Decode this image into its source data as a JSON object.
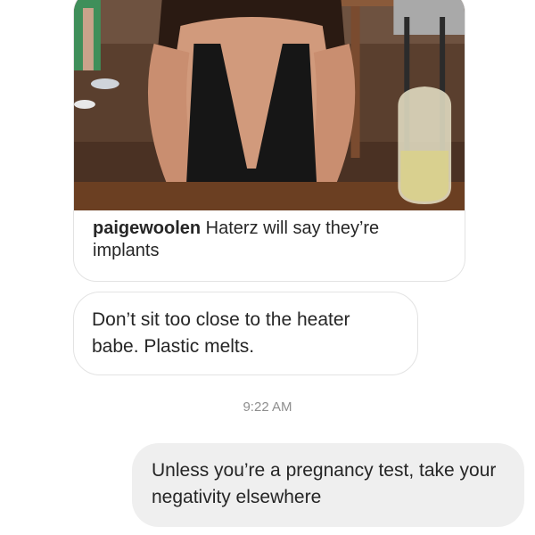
{
  "shared_post": {
    "username": "paigewoolen",
    "caption": " Haterz will say they’re implants",
    "photo_icon": "shared-post-photo"
  },
  "messages": [
    {
      "direction": "incoming",
      "text": "Don’t sit too close to the heater babe. Plastic melts."
    },
    {
      "direction": "outgoing",
      "text": "Unless you’re a pregnancy test, take your negativity elsewhere"
    }
  ],
  "timestamp": "9:22 AM",
  "colors": {
    "incoming_border": "#e3e3e3",
    "outgoing_background": "#efefef",
    "timestamp_text": "#8e8e8e"
  }
}
